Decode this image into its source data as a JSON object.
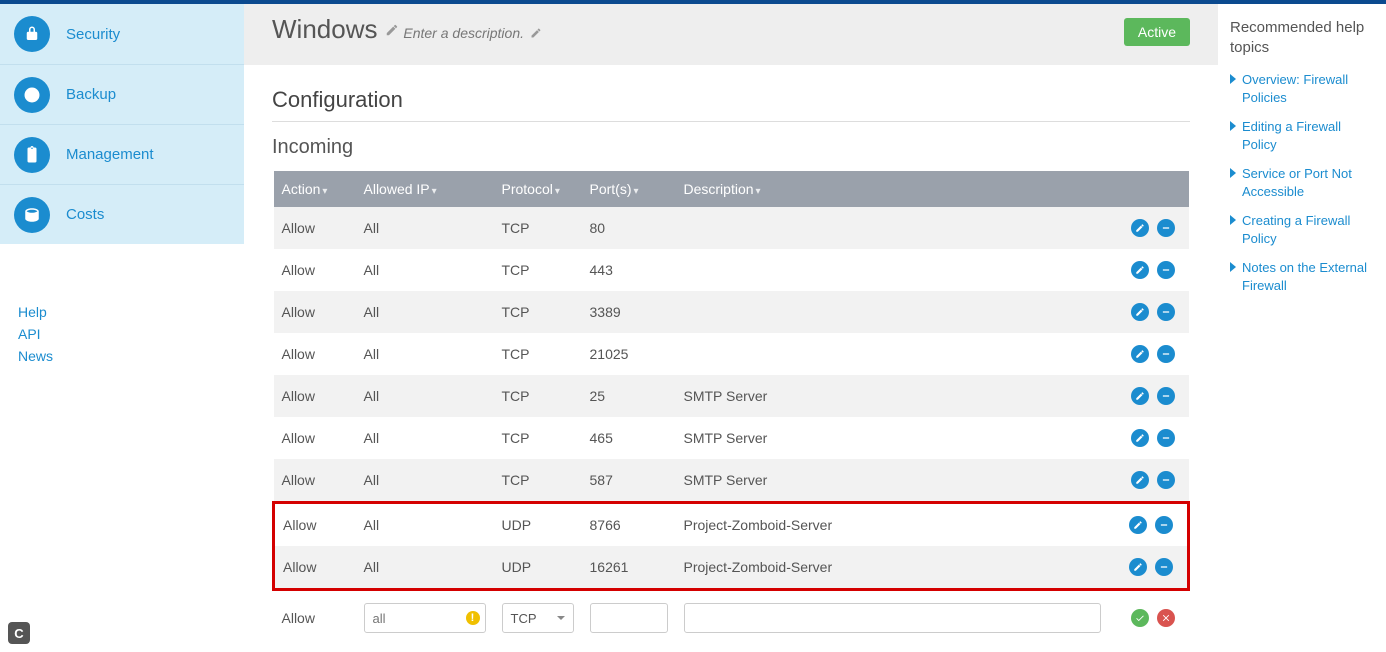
{
  "sidebar": {
    "items": [
      {
        "label": "Security",
        "icon": "lock"
      },
      {
        "label": "Backup",
        "icon": "clock"
      },
      {
        "label": "Management",
        "icon": "clipboard"
      },
      {
        "label": "Costs",
        "icon": "coins"
      }
    ],
    "links": [
      {
        "label": "Help"
      },
      {
        "label": "API"
      },
      {
        "label": "News"
      }
    ]
  },
  "header": {
    "title": "Windows",
    "description_placeholder": "Enter a description.",
    "status": "Active"
  },
  "config": {
    "section_title": "Configuration",
    "incoming_title": "Incoming",
    "columns": {
      "action": "Action",
      "allowed_ip": "Allowed IP",
      "protocol": "Protocol",
      "ports": "Port(s)",
      "description": "Description"
    },
    "rows": [
      {
        "action": "Allow",
        "ip": "All",
        "protocol": "TCP",
        "ports": "80",
        "description": ""
      },
      {
        "action": "Allow",
        "ip": "All",
        "protocol": "TCP",
        "ports": "443",
        "description": ""
      },
      {
        "action": "Allow",
        "ip": "All",
        "protocol": "TCP",
        "ports": "3389",
        "description": ""
      },
      {
        "action": "Allow",
        "ip": "All",
        "protocol": "TCP",
        "ports": "21025",
        "description": ""
      },
      {
        "action": "Allow",
        "ip": "All",
        "protocol": "TCP",
        "ports": "25",
        "description": "SMTP Server"
      },
      {
        "action": "Allow",
        "ip": "All",
        "protocol": "TCP",
        "ports": "465",
        "description": "SMTP Server"
      },
      {
        "action": "Allow",
        "ip": "All",
        "protocol": "TCP",
        "ports": "587",
        "description": "SMTP Server"
      },
      {
        "action": "Allow",
        "ip": "All",
        "protocol": "UDP",
        "ports": "8766",
        "description": "Project-Zomboid-Server",
        "highlight": true
      },
      {
        "action": "Allow",
        "ip": "All",
        "protocol": "UDP",
        "ports": "16261",
        "description": "Project-Zomboid-Server",
        "highlight": true
      }
    ],
    "add_row": {
      "action": "Allow",
      "ip_placeholder": "all",
      "protocol_selected": "TCP",
      "ports_value": "",
      "description_value": ""
    }
  },
  "help": {
    "title": "Recommended help topics",
    "links": [
      "Overview: Firewall Policies",
      "Editing a Firewall Policy",
      "Service or Port Not Accessible",
      "Creating a Firewall Policy",
      "Notes on the External Firewall"
    ]
  }
}
